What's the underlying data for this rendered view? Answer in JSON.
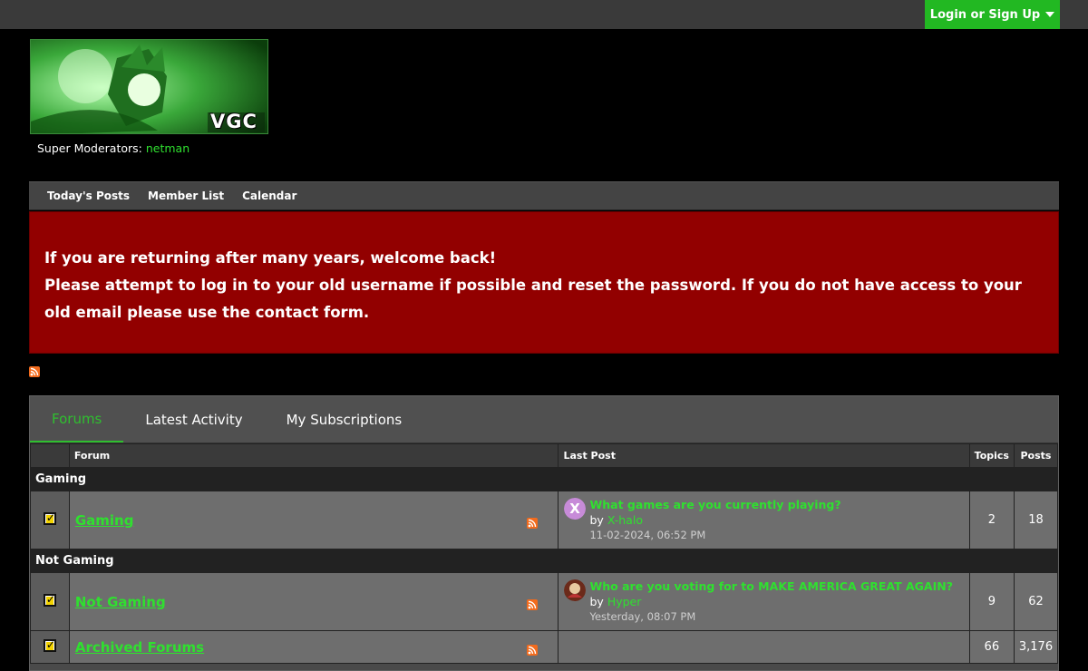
{
  "header": {
    "login_label": "Login or Sign Up",
    "logo_text": "VGC",
    "mods_label": "Super Moderators:",
    "mods_user": "netman"
  },
  "nav": {
    "items": [
      "Today's Posts",
      "Member List",
      "Calendar"
    ]
  },
  "notice": {
    "line1": "If you are returning after many years, welcome back!",
    "line2": "Please attempt to log in to your old username if possible and reset the password. If you do not have access to your old email please use the contact form."
  },
  "tabs": {
    "items": [
      "Forums",
      "Latest Activity",
      "My Subscriptions"
    ],
    "active": "Forums"
  },
  "table": {
    "headers": {
      "forum": "Forum",
      "last_post": "Last Post",
      "topics": "Topics",
      "posts": "Posts"
    },
    "categories": [
      {
        "name": "Gaming",
        "forums": [
          {
            "name": "Gaming",
            "last_title": "What games are you currently playing?",
            "by_prefix": "by",
            "by_user": "X-halo",
            "date": "11-02-2024, 06:52 PM",
            "topics": "2",
            "posts": "18"
          }
        ]
      },
      {
        "name": "Not Gaming",
        "forums": [
          {
            "name": "Not Gaming",
            "last_title": "Who are you voting for to MAKE AMERICA GREAT AGAIN?",
            "by_prefix": "by",
            "by_user": "Hyper",
            "date": "Yesterday, 08:07 PM",
            "topics": "9",
            "posts": "62"
          },
          {
            "name": "Archived Forums",
            "last_title": "",
            "by_prefix": "",
            "by_user": "",
            "date": "",
            "topics": "66",
            "posts": "3,176"
          }
        ]
      }
    ]
  },
  "colors": {
    "accent_green": "#2fe02f",
    "notice_red": "#920000",
    "button_green": "#22b822"
  }
}
